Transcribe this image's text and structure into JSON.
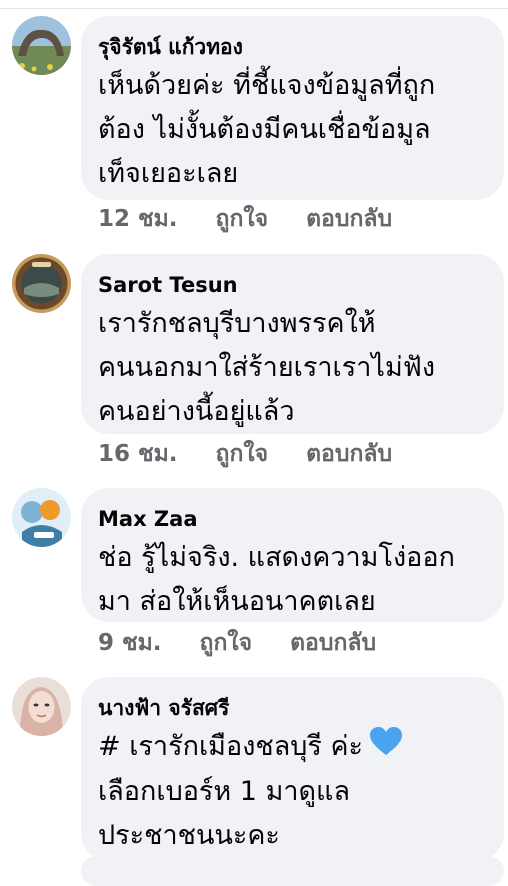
{
  "comments": [
    {
      "name": "รุจิรัตน์ แก้วทอง",
      "lines": [
        "เห็นด้วยค่ะ ที่ชี้แจงข้อมูลที่ถูก",
        "ต้อง ไม่งั้นต้องมีคนเชื่อข้อมูล",
        "เท็จเยอะเลย"
      ],
      "time": "12 ชม.",
      "like": "ถูกใจ",
      "reply": "ตอบกลับ",
      "avatar_icon": "landscape-photo-avatar",
      "avatar_color": "#6f8a54"
    },
    {
      "name": "Sarot Tesun",
      "lines": [
        "เรารักชลบุรีบางพรรคให้",
        "คนนอกมาใส่ร้ายเราเราไม่ฟัง",
        "คนอย่างนี้อยู่แล้ว"
      ],
      "time": "16 ชม.",
      "like": "ถูกใจ",
      "reply": "ตอบกลับ",
      "avatar_icon": "round-badge-avatar",
      "avatar_color": "#6b4a2a"
    },
    {
      "name": "Max Zaa",
      "lines": [
        "ช่อ รู้ไม่จริง. แสดงความโง่ออก",
        "มา ส่อให้เห็นอนาคตเลย"
      ],
      "time": "9 ชม.",
      "like": "ถูกใจ",
      "reply": "ตอบกลับ",
      "avatar_icon": "sticker-avatar",
      "avatar_color": "#7fb3d6"
    },
    {
      "name": "นางฟ้า จรัสศรี",
      "lines": [
        "# เรารักเมืองชลบุรี ค่ะ",
        "เลือกเบอร์ห 1 มาดูแล",
        "ประชาชนนะคะ"
      ],
      "emoji": "blue-heart-icon",
      "emoji_color": "#4aa3f0",
      "avatar_icon": "portrait-avatar",
      "avatar_color": "#d9b4a6"
    }
  ]
}
